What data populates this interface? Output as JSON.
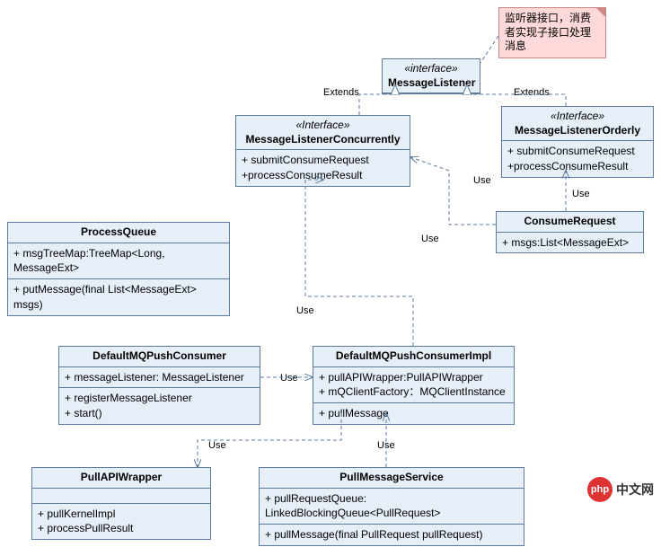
{
  "chart_data": {
    "type": "uml-class-diagram",
    "note": "监听器接口，消费者实现子接口处理消息",
    "classes": [
      {
        "id": "MessageListener",
        "stereotype": "«interface»",
        "name": "MessageListener",
        "attrs": [],
        "ops": []
      },
      {
        "id": "MessageListenerConcurrently",
        "stereotype": "«Interface»",
        "name": "MessageListenerConcurrently",
        "attrs": [],
        "ops": [
          "+ submitConsumeRequest",
          "+processConsumeResult"
        ]
      },
      {
        "id": "MessageListenerOrderly",
        "stereotype": "«Interface»",
        "name": "MessageListenerOrderly",
        "attrs": [],
        "ops": [
          "+ submitConsumeRequest",
          "+processConsumeResult"
        ]
      },
      {
        "id": "ConsumeRequest",
        "stereotype": "",
        "name": "ConsumeRequest",
        "attrs": [
          "+ msgs:List<MessageExt>"
        ],
        "ops": []
      },
      {
        "id": "ProcessQueue",
        "stereotype": "",
        "name": "ProcessQueue",
        "attrs": [
          "+ msgTreeMap:TreeMap<Long, MessageExt>"
        ],
        "ops": [
          "+ putMessage(final List<MessageExt> msgs)"
        ]
      },
      {
        "id": "DefaultMQPushConsumer",
        "stereotype": "",
        "name": "DefaultMQPushConsumer",
        "attrs": [
          "+ messageListener: MessageListener"
        ],
        "ops": [
          "+ registerMessageListener",
          "+ start()"
        ]
      },
      {
        "id": "DefaultMQPushConsumerImpl",
        "stereotype": "",
        "name": "DefaultMQPushConsumerImpl",
        "attrs": [
          "+ pullAPIWrapper:PullAPIWrapper",
          "+ mQClientFactory：MQClientInstance"
        ],
        "ops": [
          "+ pullMessage"
        ]
      },
      {
        "id": "PullAPIWrapper",
        "stereotype": "",
        "name": "PullAPIWrapper",
        "attrs": [],
        "ops": [
          "+ pullKernelImpl",
          "+ processPullResult"
        ]
      },
      {
        "id": "PullMessageService",
        "stereotype": "",
        "name": "PullMessageService",
        "attrs": [
          "+ pullRequestQueue: LinkedBlockingQueue<PullRequest>"
        ],
        "ops": [
          "+ pullMessage(final PullRequest pullRequest)"
        ]
      }
    ],
    "edges": [
      {
        "from": "MessageListenerConcurrently",
        "to": "MessageListener",
        "label": "Extends",
        "style": "dashed-triangle"
      },
      {
        "from": "MessageListenerOrderly",
        "to": "MessageListener",
        "label": "Extends",
        "style": "dashed-triangle"
      },
      {
        "from": "note",
        "to": "MessageListener",
        "label": "",
        "style": "dashed"
      },
      {
        "from": "ConsumeRequest",
        "to": "MessageListenerConcurrently",
        "label": "Use",
        "style": "dashed-arrow"
      },
      {
        "from": "ConsumeRequest",
        "to": "MessageListenerOrderly",
        "label": "Use",
        "style": "dashed-arrow"
      },
      {
        "from": "DefaultMQPushConsumerImpl",
        "to": "MessageListenerConcurrently",
        "label": "Use",
        "style": "dashed-arrow"
      },
      {
        "from": "DefaultMQPushConsumer",
        "to": "DefaultMQPushConsumerImpl",
        "label": "Use",
        "style": "dashed-arrow"
      },
      {
        "from": "DefaultMQPushConsumerImpl",
        "to": "PullAPIWrapper",
        "label": "Use",
        "style": "dashed-arrow"
      },
      {
        "from": "PullMessageService",
        "to": "DefaultMQPushConsumerImpl",
        "label": "Use",
        "style": "dashed-arrow"
      }
    ]
  },
  "logo": {
    "badge": "php",
    "text": "中文网"
  },
  "labels": {
    "extends1": "Extends",
    "extends2": "Extends",
    "use1": "Use",
    "use2": "Use",
    "use3": "Use",
    "use4": "Use",
    "use5": "Use",
    "use6": "Use"
  }
}
